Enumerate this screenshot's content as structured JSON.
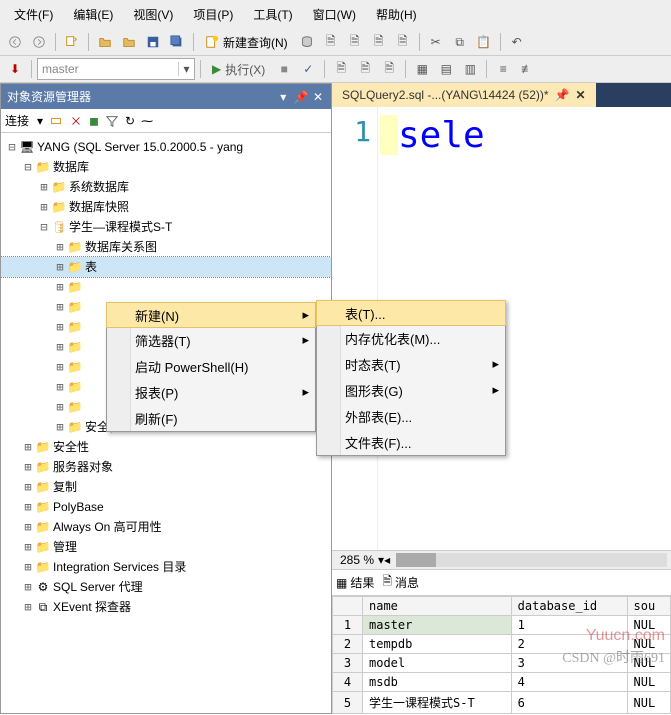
{
  "menubar": [
    "文件(F)",
    "编辑(E)",
    "视图(V)",
    "项目(P)",
    "工具(T)",
    "窗口(W)",
    "帮助(H)"
  ],
  "toolbar": {
    "new_query": "新建查询(N)",
    "execute": "执行(X)",
    "combo_value": "master"
  },
  "explorer": {
    "title": "对象资源管理器",
    "connect": "连接",
    "tree": {
      "root": "YANG (SQL Server 15.0.2000.5 - yang",
      "databases": "数据库",
      "sysdb": "系统数据库",
      "snapshot": "数据库快照",
      "student": "学生—课程模式S-T",
      "diagram": "数据库关系图",
      "tables": "表",
      "security_db": "安全性",
      "security": "安全性",
      "server_obj": "服务器对象",
      "replication": "复制",
      "polybase": "PolyBase",
      "alwayson": "Always On 高可用性",
      "management": "管理",
      "integration": "Integration Services 目录",
      "agent": "SQL Server 代理",
      "xevent": "XEvent 探查器"
    }
  },
  "editor": {
    "tab": "SQLQuery2.sql -...(YANG\\14424 (52))*",
    "line_no": "1",
    "code": "sele",
    "zoom": "285 %"
  },
  "context_menu": {
    "items": [
      "新建(N)",
      "筛选器(T)",
      "启动 PowerShell(H)",
      "报表(P)",
      "刷新(F)"
    ],
    "submenu": [
      "表(T)...",
      "内存优化表(M)...",
      "时态表(T)",
      "图形表(G)",
      "外部表(E)...",
      "文件表(F)..."
    ]
  },
  "results": {
    "tab1": "结果",
    "tab2": "消息",
    "columns": [
      "name",
      "database_id",
      "sou"
    ],
    "rows": [
      [
        "1",
        "master",
        "1",
        "NUL"
      ],
      [
        "2",
        "tempdb",
        "2",
        "NUL"
      ],
      [
        "3",
        "model",
        "3",
        "NUL"
      ],
      [
        "4",
        "msdb",
        "4",
        "NUL"
      ],
      [
        "5",
        "学生一课程模式S-T",
        "6",
        "NUL"
      ]
    ]
  },
  "watermark1": "Yuucn.com",
  "watermark2": "CSDN @时雨691"
}
